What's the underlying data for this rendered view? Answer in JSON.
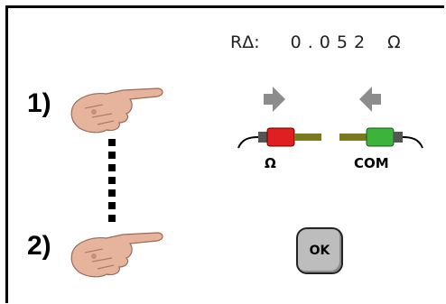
{
  "measurement": {
    "label": "RΔ:",
    "value": "0.052",
    "unit": "Ω"
  },
  "steps": [
    {
      "number": "1)"
    },
    {
      "number": "2)"
    }
  ],
  "probes": {
    "left": {
      "label": "Ω",
      "color": "#e02020"
    },
    "right": {
      "label": "COM",
      "color": "#3cb43c"
    }
  },
  "ok_button": {
    "label": "OK"
  },
  "colors": {
    "arrow": "#8c8c8c",
    "lead": "#7a7a1e",
    "skin": "#e8b8a0"
  }
}
